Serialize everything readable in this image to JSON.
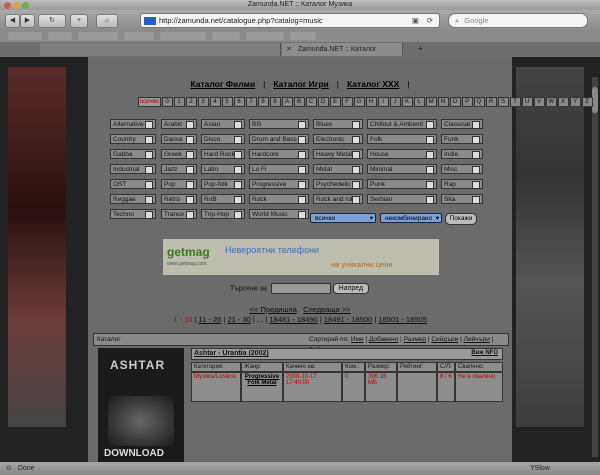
{
  "window": {
    "title": "Zamunda.NET :: Каталог Музика"
  },
  "toolbar": {
    "url": "http://zamunda.net/catalogue.php?catalog=music",
    "search_placeholder": "Google"
  },
  "tabs": [
    {
      "label": "Zamunda.NET :: Каталог Музика"
    }
  ],
  "catalog_links": {
    "films": "Каталог Филми",
    "games": "Каталог Игри",
    "xxx": "Каталог XXX"
  },
  "letters": [
    "всички",
    "0",
    "1",
    "2",
    "3",
    "4",
    "5",
    "6",
    "7",
    "8",
    "9",
    "A",
    "B",
    "C",
    "D",
    "E",
    "F",
    "G",
    "H",
    "I",
    "J",
    "K",
    "L",
    "M",
    "N",
    "O",
    "P",
    "Q",
    "R",
    "S",
    "T",
    "U",
    "V",
    "W",
    "X",
    "Y",
    "Z"
  ],
  "genres": [
    [
      "Alternative",
      "Arabic",
      "Asian",
      "BG",
      "Blues",
      "Chillout & Ambient",
      "Classical"
    ],
    [
      "Country",
      "Dance",
      "Disco",
      "Drum and Bass",
      "Electronic",
      "Folk",
      "Funk"
    ],
    [
      "Gabba",
      "Greek",
      "Hard Rock",
      "Hardcore",
      "Heavy Metal",
      "House",
      "Indie"
    ],
    [
      "Industrial",
      "Jazz",
      "Latin",
      "Lo Fi",
      "Metal",
      "Minimal",
      "Misc"
    ],
    [
      "OST",
      "Pop",
      "Pop-folk",
      "Progressive",
      "Psychedelic",
      "Punk",
      "Rap"
    ],
    [
      "Reggae",
      "Retro",
      "RnB",
      "Rock",
      "Rock and roll",
      "Serbian",
      "Ska"
    ],
    [
      "Techno",
      "Trance",
      "Trip-Hop",
      "World Music"
    ]
  ],
  "filters": {
    "select1": "всички",
    "select2": "некомбинирано",
    "show_button": "Покажи"
  },
  "banner": {
    "logo": "getmag",
    "logo_sub": "www.getmag.com",
    "headline": "Невероятни телефони",
    "subline": "на уникални цени"
  },
  "search": {
    "label": "Търсене за",
    "button": "Напред"
  },
  "pager": {
    "prev": "<< Предишна",
    "next": "Следваща >>",
    "ranges": [
      "1 - 10",
      "11 - 20",
      "21 - 30",
      "...",
      "18481 - 18490",
      "18491 - 18500",
      "18501 - 18505"
    ]
  },
  "catalog_table": {
    "header_label": "Каталог",
    "sort_label": "Сортирай по:",
    "sort_options": [
      "Име",
      "Добавено",
      "Размер",
      "Сийдъри",
      "Лийчъри",
      "Рейтинг"
    ],
    "item": {
      "title": "Ashtar - Urantia (2002)",
      "nfo_link": "Виж NFO",
      "columns": [
        "Категория:",
        "Жанр:",
        "Качено на:",
        "Ком.:",
        "Размер:",
        "Рейтинг:",
        "С/Л:",
        "Свалено:"
      ],
      "values": [
        "Музика/Losless",
        "Progressive Folk Metal",
        "2008-10-17 17:40:00",
        "0",
        "396.16 MB",
        "",
        "8 / 6",
        "Не е свалено"
      ]
    },
    "thumb_text": "ASHTAR",
    "thumb_footer": "DOWNLOAD"
  },
  "status": {
    "text": "Done",
    "ysilow": "YSlow"
  },
  "colors": {
    "accent": "#2b5fbf",
    "red": "#c40000"
  }
}
